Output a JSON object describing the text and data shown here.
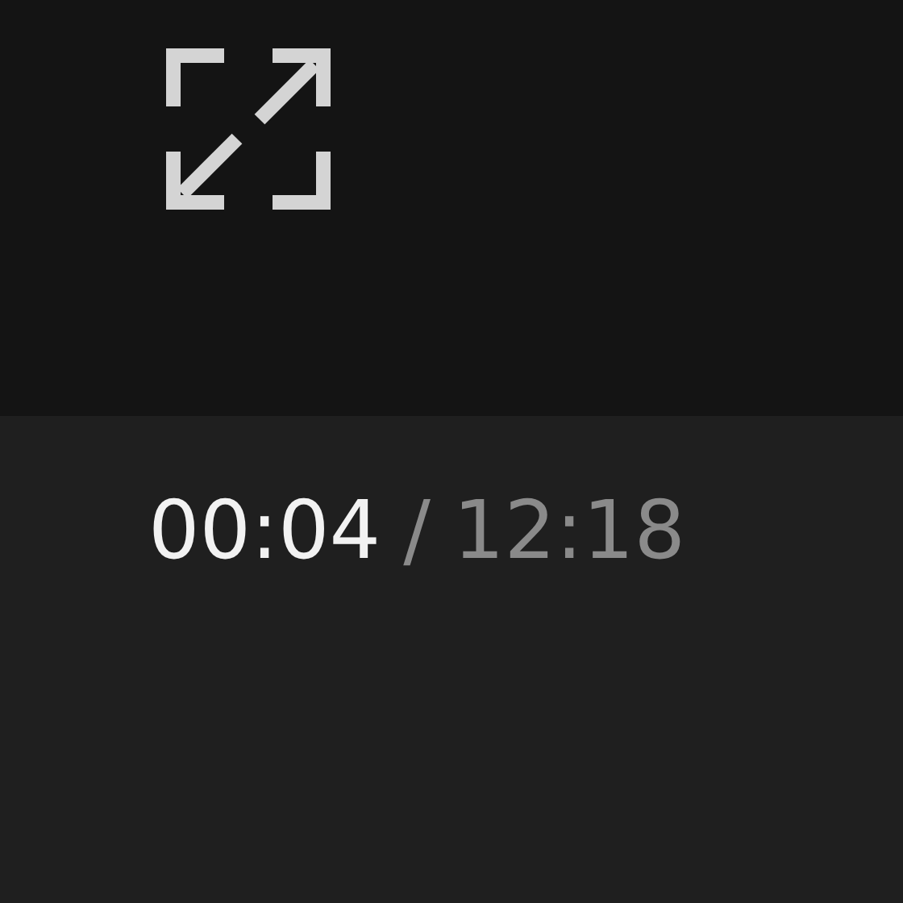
{
  "controls": {
    "current_time": "00:04",
    "separator": "/",
    "duration": "12:18"
  }
}
